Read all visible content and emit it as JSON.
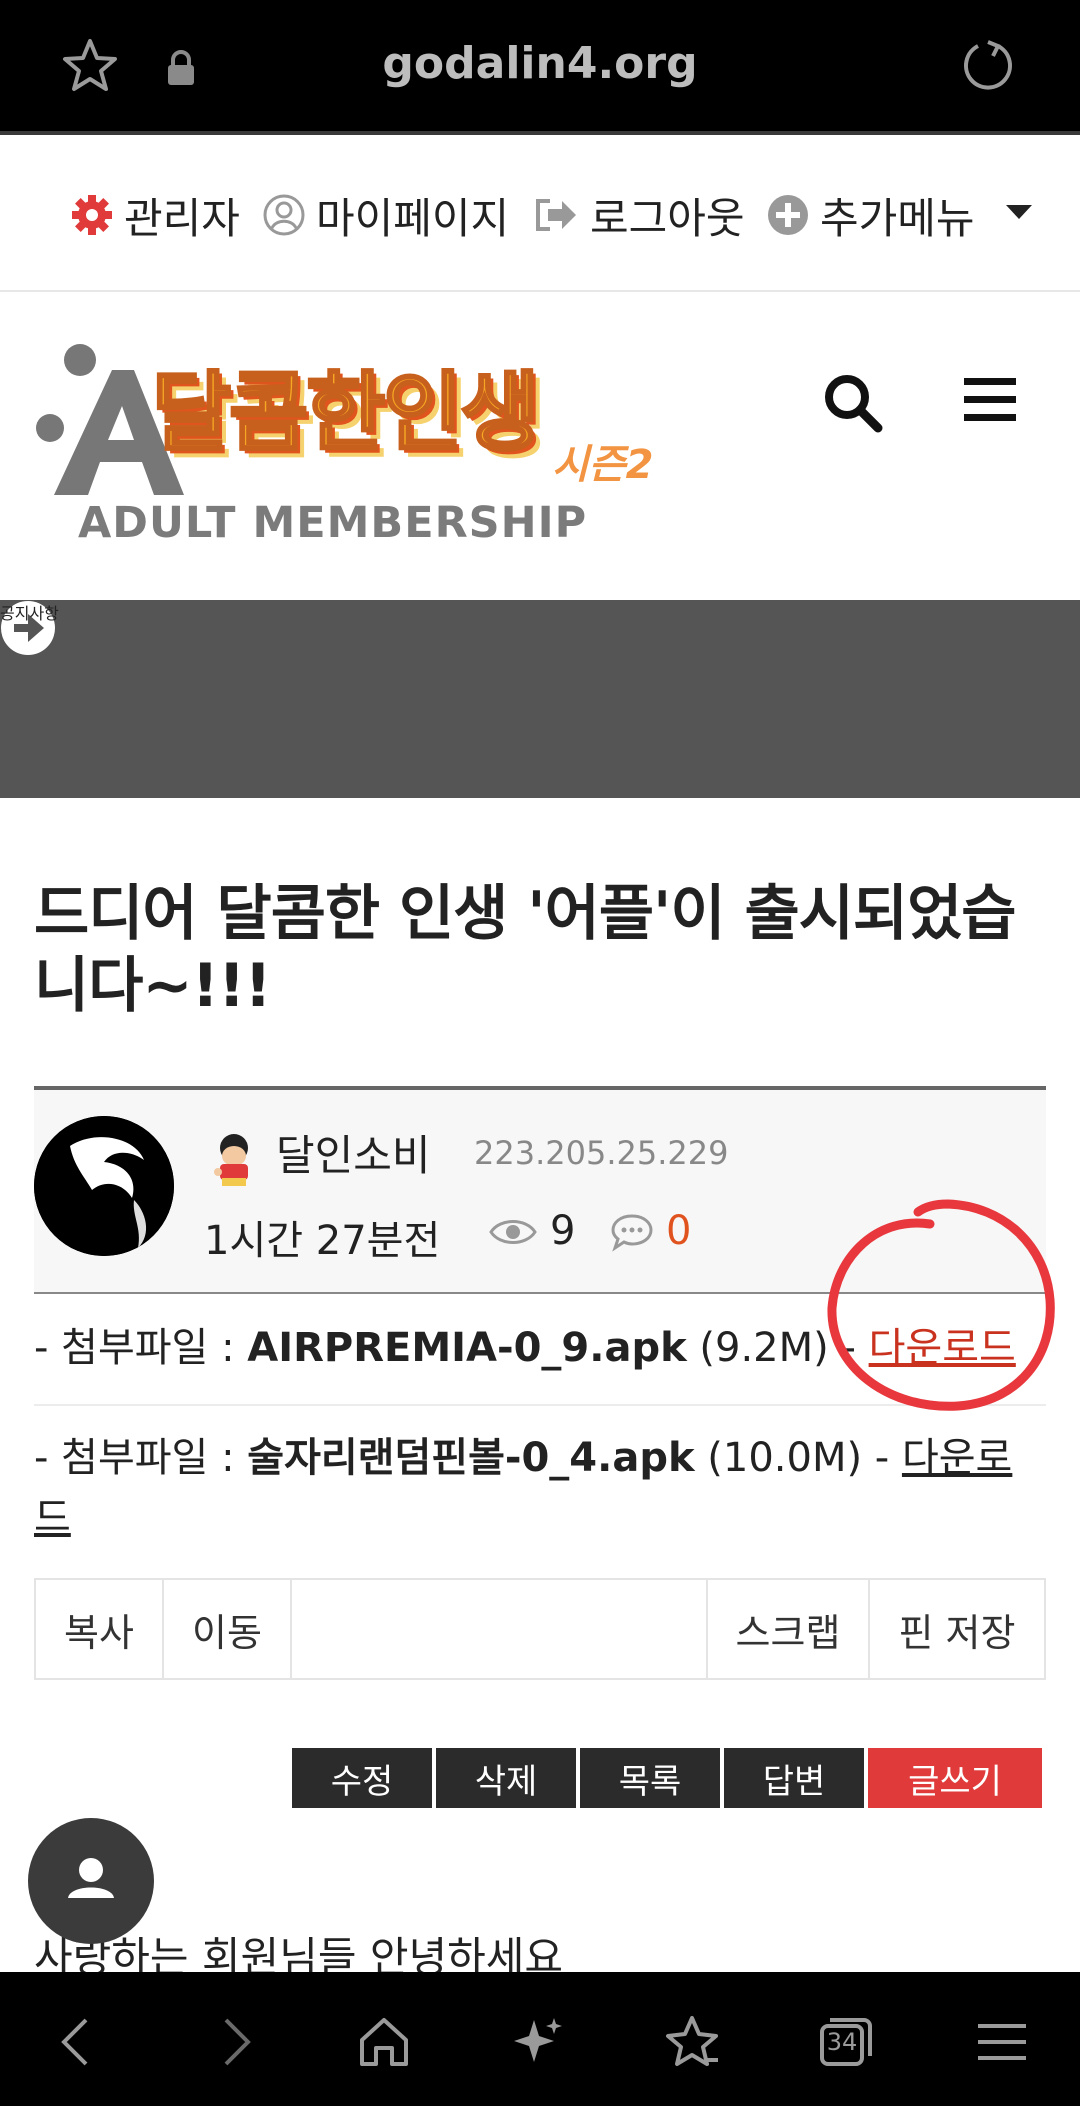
{
  "browser": {
    "url": "godalin4.org",
    "tab_count": "34"
  },
  "admin_menu": {
    "admin": "관리자",
    "mypage": "마이페이지",
    "logout": "로그아웃",
    "more": "추가메뉴"
  },
  "logo": {
    "title": "달콤한인생",
    "season": "시즌2",
    "subtitle": "ADULT MEMBERSHIP"
  },
  "section": {
    "title": "공지사항"
  },
  "post": {
    "title": "드디어 달콤한 인생 '어플'이 출시되었습니다~!!!",
    "author": "달인소비",
    "ip": "223.205.25.229",
    "time": "1시간 27분전",
    "views": "9",
    "comments": "0"
  },
  "attachments": [
    {
      "prefix": "- 첨부파일 : ",
      "filename": "AIRPREMIA-0_9.apk",
      "size": " (9.2M) - ",
      "link": "다운로드"
    },
    {
      "prefix": "- 첨부파일 : ",
      "filename": "술자리랜덤핀볼-0_4.apk",
      "size": " (10.0M) - ",
      "link": "다운로드"
    }
  ],
  "actions": {
    "copy": "복사",
    "move": "이동",
    "scrap": "스크랩",
    "pin": "핀 저장"
  },
  "buttons": {
    "edit": "수정",
    "delete": "삭제",
    "list": "목록",
    "reply": "답변",
    "write": "글쓰기"
  },
  "body": {
    "greeting": "사랑하는 회원님들 안녕하세요"
  },
  "colors": {
    "accent_red": "#e03a3a",
    "comment_orange": "#e0531f",
    "section_bg": "#555555",
    "annotation_red": "#e8383d"
  }
}
